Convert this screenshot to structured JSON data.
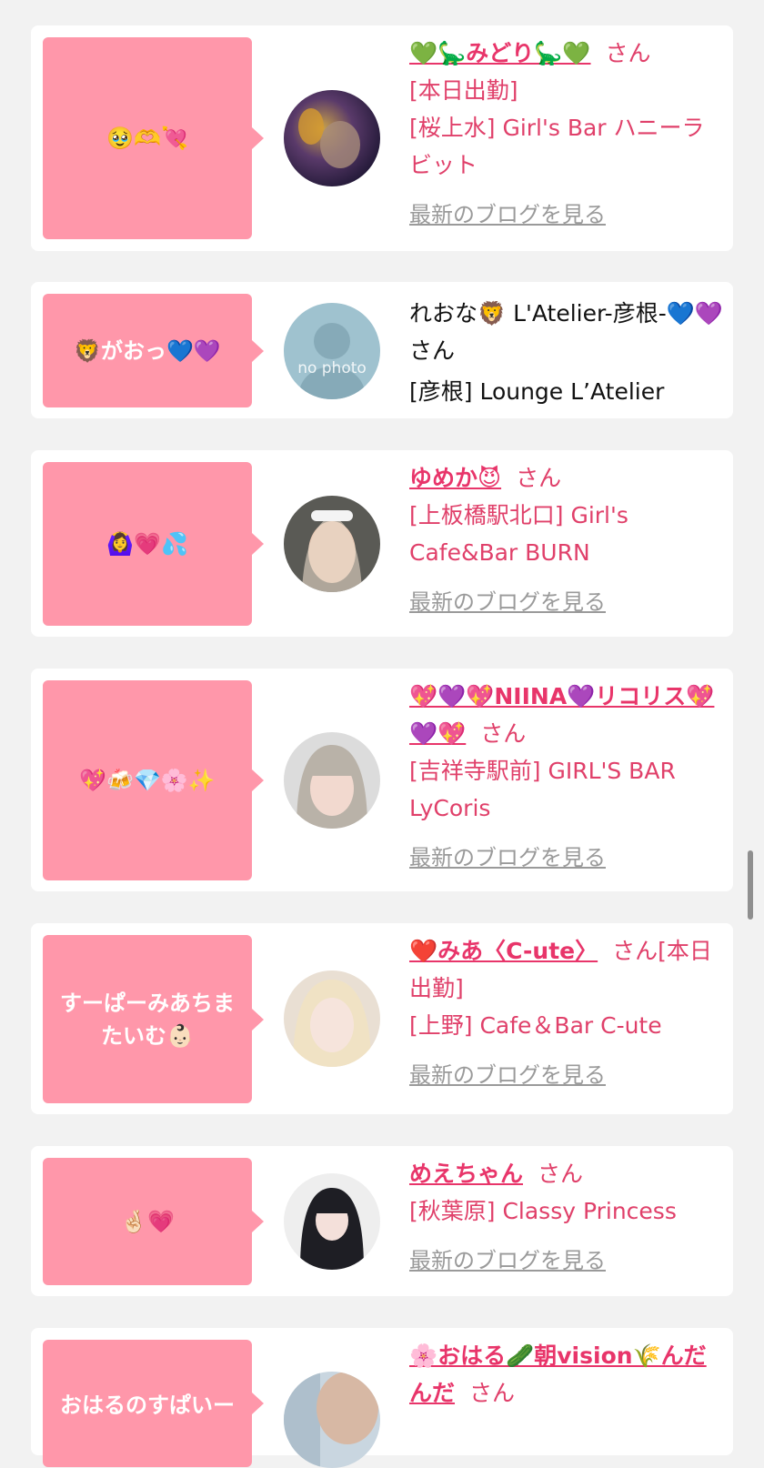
{
  "posts": [
    {
      "bubble": "🥹🫶💘",
      "name": "💚🦕みどり🦕💚",
      "san": "さん",
      "line1": "[本日出勤]",
      "line2": "[桜上水] Girl's Bar ハニーラビット",
      "blog": "最新のブログを見る"
    },
    {
      "bubble": "🦁がおっ💙💜",
      "name_plain": "れおな🦁 L'Atelier-彦根-💙💜さん",
      "line1": "[彦根] Lounge L’Atelier",
      "avatar_text": "no photo"
    },
    {
      "bubble": "🙆‍♀️💗💦",
      "name": "ゆめか😈",
      "san": "さん",
      "line1": "[上板橋駅北口] Girl's Cafe&Bar BURN",
      "blog": "最新のブログを見る"
    },
    {
      "bubble": "💖🍻💎🌸✨",
      "name": "💖💜💖NIINA💜リコリス💖💜💖",
      "san": "さん",
      "line1": "[吉祥寺駅前] GIRL'S BAR LyCoris",
      "blog": "最新のブログを見る"
    },
    {
      "bubble": "すーぱーみあちまたいむ👶🏻",
      "name": "❤️みあ〈C-ute〉",
      "san": "さん[本日出勤]",
      "line1": "[上野] Cafe＆Bar C-ute",
      "blog": "最新のブログを見る"
    },
    {
      "bubble": "🤞🏻💗",
      "name": "めえちゃん",
      "san": "さん",
      "line1": "[秋葉原] Classy Princess",
      "blog": "最新のブログを見る"
    },
    {
      "bubble": "おはるのすぱいー",
      "name": "🌸おはる🥒朝vision🌾んだんだ",
      "san": "さん"
    }
  ]
}
